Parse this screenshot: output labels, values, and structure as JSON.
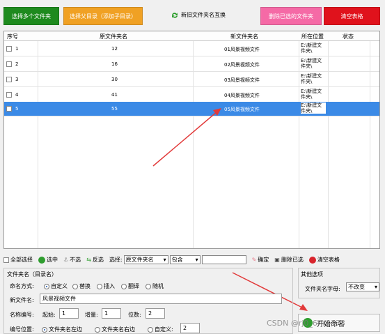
{
  "top_buttons": {
    "select_files": "选择多个文件夹",
    "select_parent": "选择父目录（添加子目录）",
    "swap": "新旧文件夹名互换",
    "delete_selected": "删除已选的文件夹",
    "clear_table": "清空表格"
  },
  "table": {
    "headers": [
      "序号",
      "原文件夹名",
      "新文件夹名",
      "所在位置",
      "状态"
    ],
    "rows": [
      {
        "index": "1",
        "orig": "12",
        "new": "01风景视频文件",
        "loc": "E:\\新建文件夹\\",
        "status": ""
      },
      {
        "index": "2",
        "orig": "16",
        "new": "02风景视频文件",
        "loc": "E:\\新建文件夹\\",
        "status": ""
      },
      {
        "index": "3",
        "orig": "30",
        "new": "03风景视频文件",
        "loc": "E:\\新建文件夹\\",
        "status": ""
      },
      {
        "index": "4",
        "orig": "41",
        "new": "04风景视频文件",
        "loc": "E:\\新建文件夹\\",
        "status": ""
      },
      {
        "index": "5",
        "orig": "55",
        "new": "05风景视频文件",
        "loc": "E:\\新建文件夹\\",
        "status": ""
      }
    ]
  },
  "toolbar": {
    "select_all": "全部选择",
    "check": "选中",
    "uncheck": "不选",
    "invert": "反选",
    "choose_label": "选择:",
    "field_value": "原文件夹名",
    "match_value": "包含",
    "confirm": "确定",
    "delete_selected": "删除已选",
    "clear_table": "清空表格"
  },
  "settings": {
    "group_title": "文件夹名（目录名）",
    "naming_label": "命名方式:",
    "naming_options": [
      "自定义",
      "替换",
      "插入",
      "翻译",
      "随机"
    ],
    "new_name_label": "新文件名:",
    "new_name_value": "风景视频文件",
    "number_label": "名称编号:",
    "start_label": "起始:",
    "start_value": "1",
    "step_label": "增量:",
    "step_value": "1",
    "digits_label": "位数:",
    "digits_value": "2",
    "position_label": "编号位置:",
    "position_options": [
      "文件夹名左边",
      "文件夹名右边",
      "自定义:"
    ],
    "custom_value": "2"
  },
  "other": {
    "title": "其他选项",
    "case_label": "文件夹名字母:",
    "case_value": "不改变",
    "start_button": "开始命名"
  },
  "watermark": "CSDN @rj0_6rjr3173",
  "colors": {
    "green": "#1e8a1e",
    "orange": "#f0a124",
    "pink": "#f56aa6",
    "red": "#e0121c",
    "selection": "#3b8ae6",
    "arrow": "#e23a3a"
  }
}
